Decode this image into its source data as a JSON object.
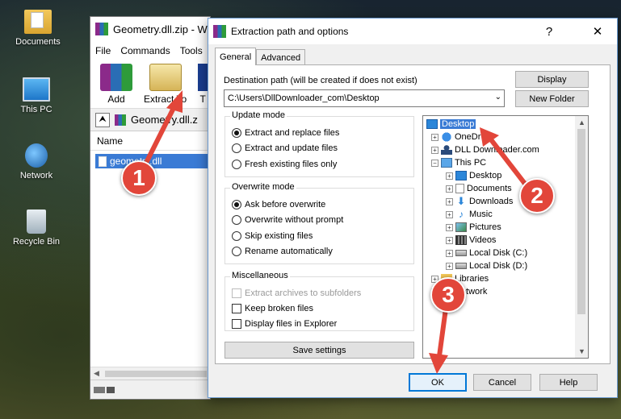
{
  "desktop": {
    "icons": [
      {
        "label": "Documents",
        "icon": "documents-folder-icon"
      },
      {
        "label": "This PC",
        "icon": "this-pc-icon"
      },
      {
        "label": "Network",
        "icon": "network-icon"
      },
      {
        "label": "Recycle Bin",
        "icon": "recycle-bin-icon"
      }
    ]
  },
  "winrar": {
    "title": "Geometry.dll.zip - W",
    "menu": [
      "File",
      "Commands",
      "Tools"
    ],
    "toolbar": [
      {
        "label": "Add",
        "icon": "add-archive-icon"
      },
      {
        "label": "Extract To",
        "icon": "extract-to-icon"
      },
      {
        "label": "T",
        "icon": "test-icon"
      }
    ],
    "path_text": "Geometry.dll.z",
    "column_name": "Name",
    "file": "geometry.dll"
  },
  "dialog": {
    "title": "Extraction path and options",
    "help": "?",
    "close": "✕",
    "tabs": [
      "General",
      "Advanced"
    ],
    "dest_label": "Destination path (will be created if does not exist)",
    "dest_value": "C:\\Users\\DllDownloader_com\\Desktop",
    "display_button": "Display",
    "new_folder_button": "New Folder",
    "update_mode": {
      "title": "Update mode",
      "options": [
        "Extract and replace files",
        "Extract and update files",
        "Fresh existing files only"
      ],
      "selected": 0
    },
    "overwrite_mode": {
      "title": "Overwrite mode",
      "options": [
        "Ask before overwrite",
        "Overwrite without prompt",
        "Skip existing files",
        "Rename automatically"
      ],
      "selected": 0
    },
    "misc": {
      "title": "Miscellaneous",
      "options": [
        "Extract archives to subfolders",
        "Keep broken files",
        "Display files in Explorer"
      ]
    },
    "save_settings": "Save settings",
    "tree": {
      "desktop": "Desktop",
      "onedrive": "OneDr",
      "dlldownloader": "DLL Downloader.com",
      "this_pc": "This PC",
      "pc_children": [
        "Desktop",
        "Documents",
        "Downloads",
        "Music",
        "Pictures",
        "Videos",
        "Local Disk (C:)",
        "Local Disk (D:)"
      ],
      "libraries": "Libraries",
      "network": "Network"
    },
    "ok": "OK",
    "cancel": "Cancel",
    "help_button": "Help"
  },
  "annotations": {
    "step1": "1",
    "step2": "2",
    "step3": "3",
    "color": "#e2463a"
  }
}
